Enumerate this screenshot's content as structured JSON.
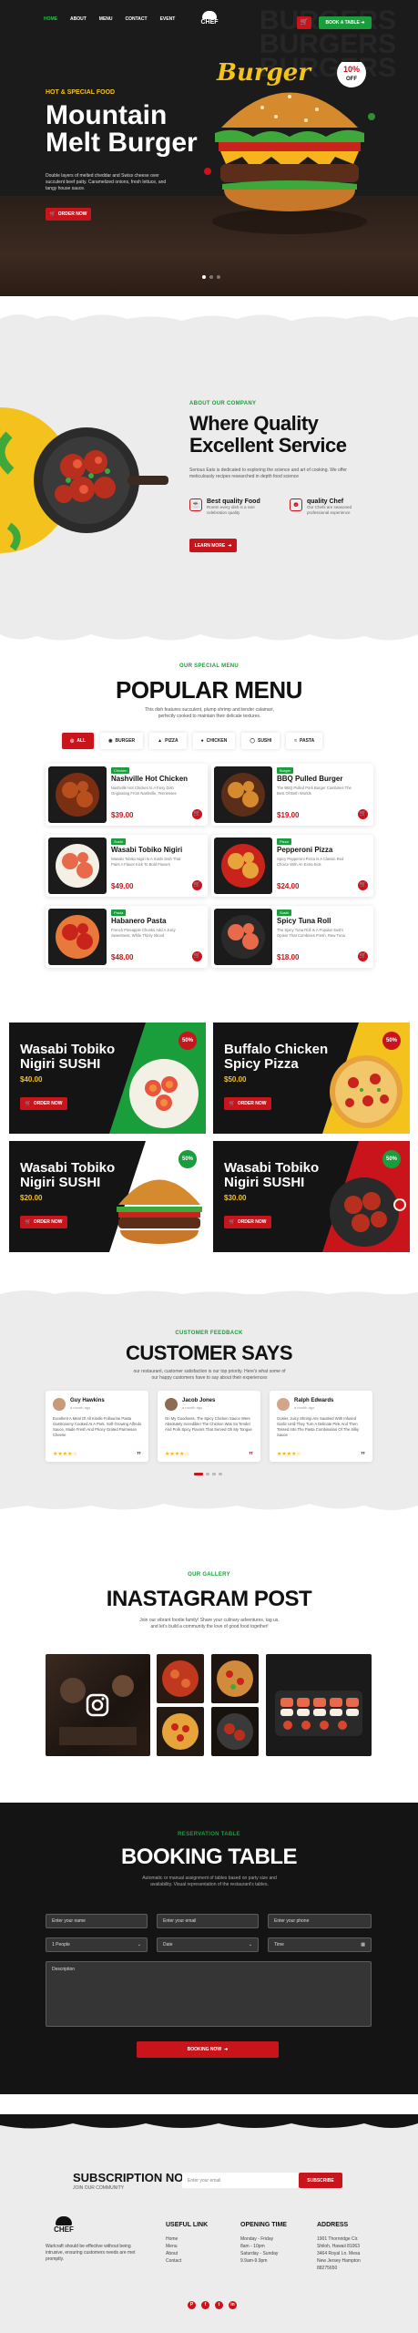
{
  "colors": {
    "brand_red": "#c9141b",
    "brand_green": "#1a9d3b",
    "accent_yellow": "#f4c21d",
    "dark": "#141414"
  },
  "header": {
    "nav": [
      "HOME",
      "ABOUT",
      "MENU",
      "CONTACT",
      "EVENT"
    ],
    "logo_text": "CHEF",
    "book_btn": "BOOK A TABLE",
    "cart_icon": "cart-icon"
  },
  "hero": {
    "subtitle": "HOT & SPECIAL FOOD",
    "title": "Mountain Melt Burger",
    "description": "Double layers of melted cheddar and Swiss cheese over succulent beef patty. Caramelized onions, fresh lettuce, and tangy house sauce.",
    "button": "ORDER NOW",
    "script_word": "Burger",
    "discount_top": "10%",
    "discount_bottom": "OFF",
    "ghost_text": "BURGERS"
  },
  "about": {
    "label": "ABOUT OUR COMPANY",
    "title": "Where Quality Excellent Service",
    "description": "Serious Eats is dedicated to exploring the science and art of cooking. We offer meticulously recipes researched in depth food science",
    "features": [
      {
        "title": "Best quality Food",
        "text": "Rorem every dish is a rare celebration quality",
        "icon": "food-icon"
      },
      {
        "title": "quality Chef",
        "text": "Our Chefs are seasoned professional experience",
        "icon": "chef-icon"
      }
    ],
    "button": "LEARN MORE"
  },
  "menu": {
    "label": "OUR SPECIAL MENU",
    "title": "POPULAR MENU",
    "description": "This dish features succulent, plump shrimp and tender calamari, perfectly cooked to maintain their delicate textures.",
    "tabs": [
      "ALL",
      "BURGER",
      "PIZZA",
      "CHICKEN",
      "SUSHI",
      "PASTA"
    ],
    "items": [
      {
        "badge": "Chicken",
        "name": "Nashville Hot Chicken",
        "desc": "Nashville Hot Chicken Is A Fiery Dish Originating From Nashville, Tennessee",
        "price": "$39.00"
      },
      {
        "badge": "Burger",
        "name": "BBQ Pulled Burger",
        "desc": "The BBQ Pulled Pork Burger Combines The Best Of Both Worlds",
        "price": "$19.00"
      },
      {
        "badge": "Sushi",
        "name": "Wasabi Tobiko Nigiri",
        "desc": "Wasabi Tobiko Nigiri Is A Sushi Dish That Pairs A Flavor Kick To Bold Flavors",
        "price": "$49.00"
      },
      {
        "badge": "Pizza",
        "name": "Pepperoni Pizza",
        "desc": "Spicy Pepperoni Pizza Is A Classic Red Choice With An Extra Kick",
        "price": "$24.00"
      },
      {
        "badge": "Pasta",
        "name": "Habanero Pasta",
        "desc": "French Pineapple Chunks Add A Juicy Sweetness, While Thinly Sliced",
        "price": "$48.00"
      },
      {
        "badge": "Sushi",
        "name": "Spicy Tuna Roll",
        "desc": "The Spicy Tuna Roll Is A Popular Sushi Option That Combines Fresh, Raw Tuna",
        "price": "$18.00"
      }
    ]
  },
  "promos": [
    {
      "title": "Wasabi Tobiko Nigiri SUSHI",
      "price": "$40.00",
      "off": "50%",
      "button": "ORDER NOW"
    },
    {
      "title": "Buffalo Chicken Spicy Pizza",
      "price": "$50.00",
      "off": "50%",
      "button": "ORDER NOW"
    },
    {
      "title": "Wasabi Tobiko Nigiri SUSHI",
      "price": "$20.00",
      "off": "50%",
      "button": "ORDER NOW"
    },
    {
      "title": "Wasabi Tobiko Nigiri SUSHI",
      "price": "$30.00",
      "off": "50%",
      "button": "ORDER NOW"
    }
  ],
  "testimonials": {
    "label": "CUSTOMER FEEDBACK",
    "title": "CUSTOMER SAYS",
    "description": "our restaurant, customer satisfaction is our top priority. Here's what some of our happy customers have to say about their experiences",
    "items": [
      {
        "name": "Guy Hawkins",
        "time": "a month ago",
        "text": "Excellent A Meal Of All Kindle Follourine Pasta Gastronomy Cooked At A Pork, Soft Growing Alfredo Sauce, Made Fresh And Pricey Grated Parmesan Cheese",
        "stars": "★★★★☆"
      },
      {
        "name": "Jacob Jones",
        "time": "a month ago",
        "text": "On My Goodness, The Spicy Chicken Sauce Were Absolutely Incredible! The Chicken Was So Tender And Pork Spicy Flavors That Served Oh My Tongue",
        "stars": "★★★★☆"
      },
      {
        "name": "Ralph Edwards",
        "time": "a month ago",
        "text": "Gosler, Juicy Shrimp Are Sautéed With Infused Garlic Until They Turn A Delicate Pink And Then Tossed Into The Pasta Combination Of The Silky Sauce",
        "stars": "★★★★☆"
      }
    ]
  },
  "gallery": {
    "label": "OUR GALLERY",
    "title": "INASTAGRAM POST",
    "description": "Join our vibrant foodie family! Share your culinary adventures, tag us, and let's build a community the love of good food together!",
    "icon": "instagram-icon"
  },
  "booking": {
    "label": "RESERVATION TABLE",
    "title": "BOOKING TABLE",
    "description": "Automatic or manual assignment of tables based on party size and availability. Visual representation of the restaurant's tables.",
    "name_ph": "Enter your name",
    "email_ph": "Enter your email",
    "phone_ph": "Enter your phone",
    "people": "1 People",
    "date": "Date",
    "time": "Time",
    "message_ph": "Description",
    "button": "BOOKING NOW"
  },
  "footer": {
    "sub_title": "SUBSCRIPTION NOW",
    "sub_small": "JOIN OUR COMMUNITY",
    "email_ph": "Enter your email",
    "sub_btn": "SUBSCRIBE",
    "about": "Warlcraft should be effective without being intrusive, ensuring customers needs are met promptly.",
    "links_title": "USEFUL LINK",
    "links": [
      "Home",
      "Menu",
      "About",
      "Contact"
    ],
    "hours_title": "OPENING TIME",
    "hours": [
      "Monday - Friday",
      "8am - 10pm",
      "Saturday - Sunday",
      "9.9am-9.9pm"
    ],
    "addr_title": "ADDRESS",
    "addr": [
      "1901 Thornridge Cir.",
      "Shiloh, Hawaii 81063",
      "3464 Royal Ln. Mesa",
      "New Jersey Hampton",
      "88275650"
    ],
    "social": [
      "P",
      "f",
      "t",
      "in"
    ]
  }
}
